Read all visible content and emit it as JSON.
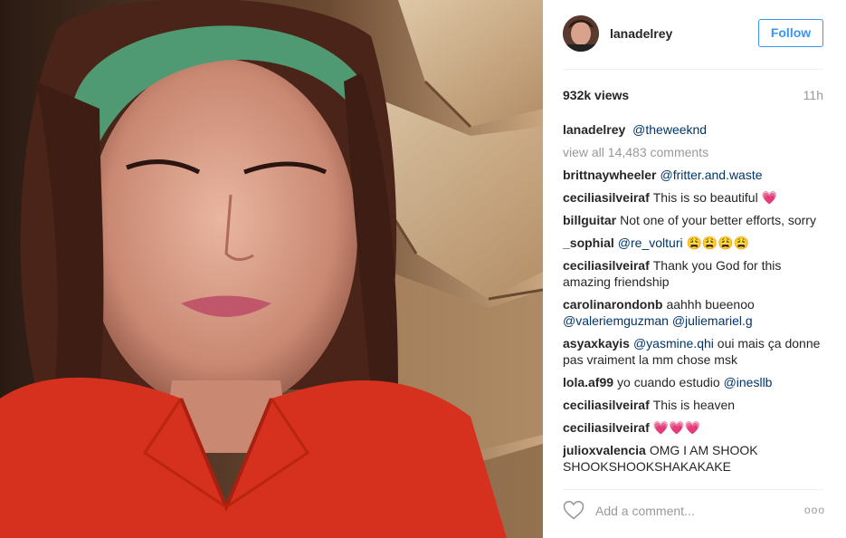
{
  "post": {
    "username": "lanadelrey",
    "follow_label": "Follow",
    "views": "932k views",
    "age": "11h",
    "caption": {
      "user": "lanadelrey",
      "text": "@theweeknd"
    },
    "view_all": "view all 14,483 comments",
    "comments": [
      {
        "user": "brittnaywheeler",
        "parts": [
          {
            "mention": "@fritter.and.waste"
          }
        ]
      },
      {
        "user": "ceciliasilveiraf",
        "parts": [
          {
            "text": "This is so beautiful "
          },
          {
            "emoji": "💗"
          }
        ]
      },
      {
        "user": "billguitar",
        "parts": [
          {
            "text": "Not one of your better efforts, sorry"
          }
        ]
      },
      {
        "user": "_sophial",
        "parts": [
          {
            "mention": "@re_volturi"
          },
          {
            "text": " "
          },
          {
            "emoji": "😩😩😩😩"
          }
        ]
      },
      {
        "user": "ceciliasilveiraf",
        "parts": [
          {
            "text": "Thank you God for this amazing friendship"
          }
        ]
      },
      {
        "user": "carolinarondonb",
        "parts": [
          {
            "text": "aahhh bueenoo "
          },
          {
            "mention": "@valeriemguzman"
          },
          {
            "text": " "
          },
          {
            "mention": "@juliemariel.g"
          }
        ]
      },
      {
        "user": "asyaxkayis",
        "parts": [
          {
            "mention": "@yasmine.qhi"
          },
          {
            "text": " oui mais ça donne pas vraiment la mm chose msk"
          }
        ]
      },
      {
        "user": "lola.af99",
        "parts": [
          {
            "text": "yo cuando estudio "
          },
          {
            "mention": "@inesllb"
          }
        ]
      },
      {
        "user": "ceciliasilveiraf",
        "parts": [
          {
            "text": "This is heaven"
          }
        ]
      },
      {
        "user": "ceciliasilveiraf",
        "parts": [
          {
            "emoji": "💗💗💗"
          }
        ]
      },
      {
        "user": "julioxvalencia",
        "parts": [
          {
            "text": "OMG I AM SHOOK SHOOKSHOOKSHAKAKAKE"
          }
        ]
      }
    ],
    "add_comment_placeholder": "Add a comment...",
    "more_label": "ooo"
  },
  "icons": {
    "like": "heart-outline-icon",
    "more": "more-options-icon"
  },
  "colors": {
    "follow": "#3897f0",
    "mention": "#003569",
    "muted": "#999999",
    "divider": "#efefef"
  }
}
